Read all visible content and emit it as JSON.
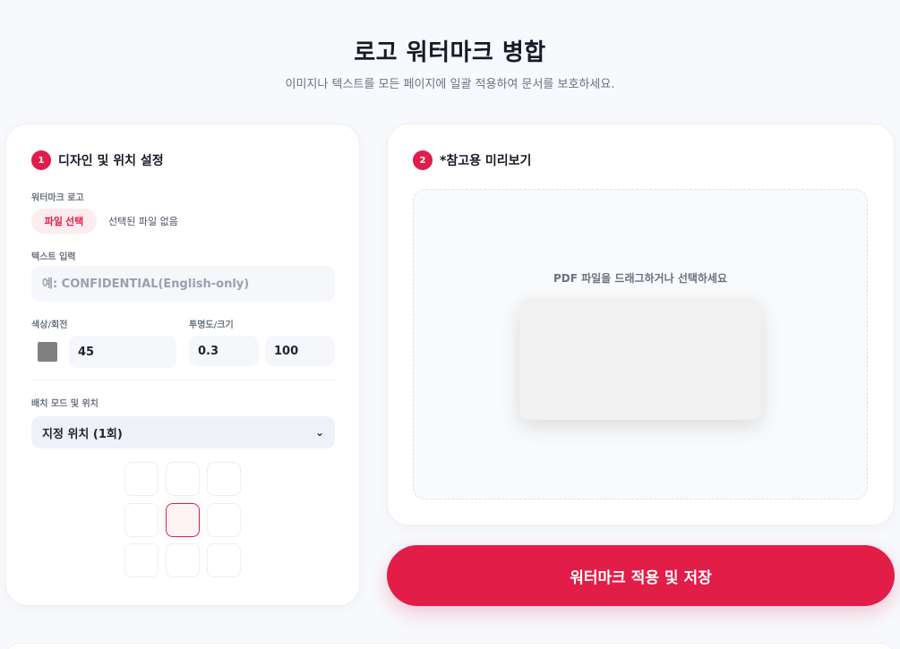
{
  "header": {
    "title": "로고 워터마크 병합",
    "subtitle": "이미지나 텍스트를 모든 페이지에 일괄 적용하여 문서를 보호하세요."
  },
  "design": {
    "step": "1",
    "title": "디자인 및 위치 설정",
    "logo_label": "워터마크 로고",
    "file_button": "파일 선택",
    "file_status": "선택된 파일 없음",
    "text_label": "텍스트 입력",
    "text_placeholder": "예: CONFIDENTIAL(English-only)",
    "color_rotate_label": "색상/회전",
    "color_value": "#808080",
    "rotation": "45",
    "opacity_size_label": "투명도/크기",
    "opacity": "0.3",
    "size": "100",
    "mode_label": "배치 모드 및 위치",
    "mode_selected": "지정 위치 (1회)",
    "selected_position": "center"
  },
  "preview": {
    "step": "2",
    "title": "*참고용 미리보기",
    "drop_text": "PDF 파일을 드래그하거나 선택하세요"
  },
  "actions": {
    "apply_label": "워터마크 적용 및 저장"
  },
  "colors": {
    "accent": "#e11d48",
    "accent_light": "#fdecef"
  }
}
